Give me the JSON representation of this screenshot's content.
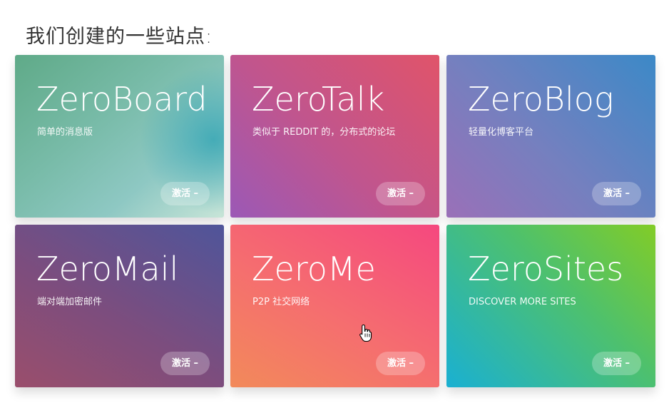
{
  "heading": "我们创建的一些站点:",
  "sites": [
    {
      "name": "ZeroBoard",
      "description": "简单的消息版",
      "button": "激活 –"
    },
    {
      "name": "ZeroTalk",
      "description": "类似于 REDDIT 的，分布式的论坛",
      "button": "激活 –"
    },
    {
      "name": "ZeroBlog",
      "description": "轻量化博客平台",
      "button": "激活 –"
    },
    {
      "name": "ZeroMail",
      "description": "端对端加密邮件",
      "button": "激活 –"
    },
    {
      "name": "ZeroMe",
      "description": "P2P 社交网络",
      "button": "激活 –"
    },
    {
      "name": "ZeroSites",
      "description": "DISCOVER MORE SITES",
      "button": "激活 –"
    }
  ],
  "icons": {
    "cursor": "hand-pointer-icon"
  }
}
